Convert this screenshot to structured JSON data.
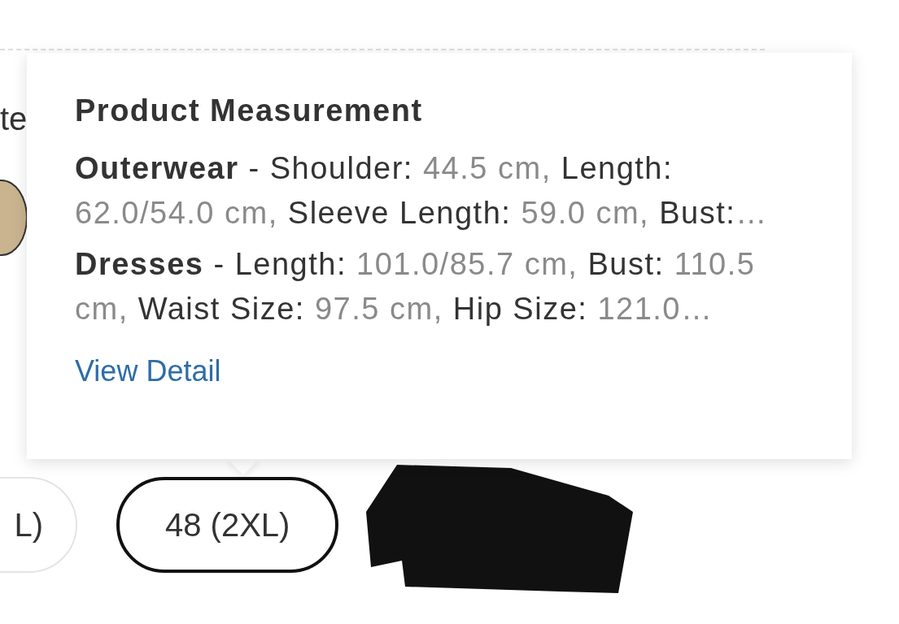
{
  "background_label": "te",
  "tooltip": {
    "title": "Product Measurement",
    "lines": [
      {
        "category": "Outerwear",
        "segments": [
          {
            "kind": "label",
            "text": " - Shoulder: "
          },
          {
            "kind": "value",
            "text": "44.5 cm, "
          },
          {
            "kind": "label",
            "text": "Length: "
          },
          {
            "kind": "value",
            "text": "62.0/54.0 cm, "
          },
          {
            "kind": "label",
            "text": "Sleeve Length: "
          },
          {
            "kind": "value",
            "text": "59.0 cm, "
          },
          {
            "kind": "label",
            "text": "Bust:"
          },
          {
            "kind": "value",
            "text": "…"
          }
        ]
      },
      {
        "category": "Dresses",
        "segments": [
          {
            "kind": "label",
            "text": " - Length: "
          },
          {
            "kind": "value",
            "text": "101.0/85.7 cm, "
          },
          {
            "kind": "label",
            "text": "Bust: "
          },
          {
            "kind": "value",
            "text": "110.5 cm, "
          },
          {
            "kind": "label",
            "text": "Waist Size: "
          },
          {
            "kind": "value",
            "text": "97.5 cm, "
          },
          {
            "kind": "label",
            "text": "Hip Size: "
          },
          {
            "kind": "value",
            "text": "121.0…"
          }
        ]
      }
    ],
    "link": "View Detail"
  },
  "sizes": [
    {
      "label": "L)",
      "selected": false
    },
    {
      "label": "48 (2XL)",
      "selected": true
    }
  ]
}
